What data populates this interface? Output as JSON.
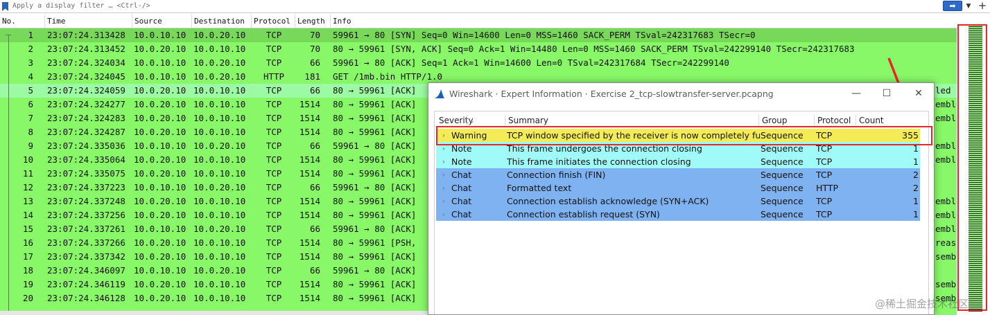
{
  "filter": {
    "placeholder": "Apply a display filter … <Ctrl-/>",
    "apply_icon": "arrow-right-icon",
    "plus_label": "+"
  },
  "columns": [
    "No.",
    "Time",
    "Source",
    "Destination",
    "Protocol",
    "Length",
    "Info"
  ],
  "packets": [
    {
      "no": "1",
      "time": "23:07:24.313428",
      "src": "10.0.10.10",
      "dst": "10.0.20.10",
      "proto": "TCP",
      "len": "70",
      "info": "59961 → 80 [SYN] Seq=0 Win=14600 Len=0 MSS=1460 SACK_PERM TSval=242317683 TSecr=0"
    },
    {
      "no": "2",
      "time": "23:07:24.313452",
      "src": "10.0.20.10",
      "dst": "10.0.10.10",
      "proto": "TCP",
      "len": "70",
      "info": "80 → 59961 [SYN, ACK] Seq=0 Ack=1 Win=14480 Len=0 MSS=1460 SACK_PERM TSval=242299140 TSecr=242317683"
    },
    {
      "no": "3",
      "time": "23:07:24.324034",
      "src": "10.0.10.10",
      "dst": "10.0.20.10",
      "proto": "TCP",
      "len": "66",
      "info": "59961 → 80 [ACK] Seq=1 Ack=1 Win=14600 Len=0 TSval=242317684 TSecr=242299140"
    },
    {
      "no": "4",
      "time": "23:07:24.324045",
      "src": "10.0.10.10",
      "dst": "10.0.20.10",
      "proto": "HTTP",
      "len": "181",
      "info": "GET /1mb.bin HTTP/1.0"
    },
    {
      "no": "5",
      "time": "23:07:24.324059",
      "src": "10.0.20.10",
      "dst": "10.0.10.10",
      "proto": "TCP",
      "len": "66",
      "info": "80 → 59961 [ACK]"
    },
    {
      "no": "6",
      "time": "23:07:24.324277",
      "src": "10.0.20.10",
      "dst": "10.0.10.10",
      "proto": "TCP",
      "len": "1514",
      "info": "80 → 59961 [ACK]"
    },
    {
      "no": "7",
      "time": "23:07:24.324283",
      "src": "10.0.20.10",
      "dst": "10.0.10.10",
      "proto": "TCP",
      "len": "1514",
      "info": "80 → 59961 [ACK]"
    },
    {
      "no": "8",
      "time": "23:07:24.324287",
      "src": "10.0.20.10",
      "dst": "10.0.10.10",
      "proto": "TCP",
      "len": "1514",
      "info": "80 → 59961 [ACK]"
    },
    {
      "no": "9",
      "time": "23:07:24.335036",
      "src": "10.0.10.10",
      "dst": "10.0.20.10",
      "proto": "TCP",
      "len": "66",
      "info": "59961 → 80 [ACK]"
    },
    {
      "no": "10",
      "time": "23:07:24.335064",
      "src": "10.0.20.10",
      "dst": "10.0.10.10",
      "proto": "TCP",
      "len": "1514",
      "info": "80 → 59961 [ACK]"
    },
    {
      "no": "11",
      "time": "23:07:24.335075",
      "src": "10.0.20.10",
      "dst": "10.0.10.10",
      "proto": "TCP",
      "len": "1514",
      "info": "80 → 59961 [ACK]"
    },
    {
      "no": "12",
      "time": "23:07:24.337223",
      "src": "10.0.10.10",
      "dst": "10.0.20.10",
      "proto": "TCP",
      "len": "66",
      "info": "59961 → 80 [ACK]"
    },
    {
      "no": "13",
      "time": "23:07:24.337248",
      "src": "10.0.20.10",
      "dst": "10.0.10.10",
      "proto": "TCP",
      "len": "1514",
      "info": "80 → 59961 [ACK]"
    },
    {
      "no": "14",
      "time": "23:07:24.337256",
      "src": "10.0.20.10",
      "dst": "10.0.10.10",
      "proto": "TCP",
      "len": "1514",
      "info": "80 → 59961 [ACK]"
    },
    {
      "no": "15",
      "time": "23:07:24.337261",
      "src": "10.0.10.10",
      "dst": "10.0.20.10",
      "proto": "TCP",
      "len": "66",
      "info": "59961 → 80 [ACK]"
    },
    {
      "no": "16",
      "time": "23:07:24.337266",
      "src": "10.0.20.10",
      "dst": "10.0.10.10",
      "proto": "TCP",
      "len": "1514",
      "info": "80 → 59961 [PSH,"
    },
    {
      "no": "17",
      "time": "23:07:24.337342",
      "src": "10.0.20.10",
      "dst": "10.0.10.10",
      "proto": "TCP",
      "len": "1514",
      "info": "80 → 59961 [ACK]"
    },
    {
      "no": "18",
      "time": "23:07:24.346097",
      "src": "10.0.10.10",
      "dst": "10.0.20.10",
      "proto": "TCP",
      "len": "66",
      "info": "59961 → 80 [ACK]"
    },
    {
      "no": "19",
      "time": "23:07:24.346119",
      "src": "10.0.20.10",
      "dst": "10.0.10.10",
      "proto": "TCP",
      "len": "1514",
      "info": "80 → 59961 [ACK]"
    },
    {
      "no": "20",
      "time": "23:07:24.346128",
      "src": "10.0.20.10",
      "dst": "10.0.10.10",
      "proto": "TCP",
      "len": "1514",
      "info": "80 → 59961 [ACK]"
    }
  ],
  "dialog": {
    "title": "Wireshark · Expert Information · Exercise 2_tcp-slowtransfer-server.pcapng",
    "icon": "shark-fin-icon",
    "minimize_label": "—",
    "maximize_label": "☐",
    "close_label": "✕",
    "columns": [
      "Severity",
      "Summary",
      "Group",
      "Protocol",
      "Count"
    ],
    "entries": [
      {
        "severity": "Warning",
        "summary": "TCP window specified by the receiver is now completely full",
        "group": "Sequence",
        "protocol": "TCP",
        "count": "355",
        "color": "#f4ec56"
      },
      {
        "severity": "Note",
        "summary": "This frame undergoes the connection closing",
        "group": "Sequence",
        "protocol": "TCP",
        "count": "1",
        "color": "#a0fbf8"
      },
      {
        "severity": "Note",
        "summary": "This frame initiates the connection closing",
        "group": "Sequence",
        "protocol": "TCP",
        "count": "1",
        "color": "#a0fbf8"
      },
      {
        "severity": "Chat",
        "summary": "Connection finish (FIN)",
        "group": "Sequence",
        "protocol": "TCP",
        "count": "2",
        "color": "#7fb2f1"
      },
      {
        "severity": "Chat",
        "summary": "Formatted text",
        "group": "Sequence",
        "protocol": "HTTP",
        "count": "2",
        "color": "#7fb2f1"
      },
      {
        "severity": "Chat",
        "summary": "Connection establish acknowledge (SYN+ACK)",
        "group": "Sequence",
        "protocol": "TCP",
        "count": "1",
        "color": "#7fb2f1"
      },
      {
        "severity": "Chat",
        "summary": "Connection establish request (SYN)",
        "group": "Sequence",
        "protocol": "TCP",
        "count": "1",
        "color": "#7fb2f1"
      }
    ]
  },
  "peek_text": [
    "led PDU",
    "embled",
    "embled",
    "embled",
    "embled",
    "embled",
    "embled",
    "embled",
    "reass",
    "sembled",
    "sembled",
    "sembled"
  ],
  "watermark": "@稀土掘金技术社区",
  "colors": {
    "packet_green": "#88f768",
    "annotation_red": "#e8262a"
  }
}
